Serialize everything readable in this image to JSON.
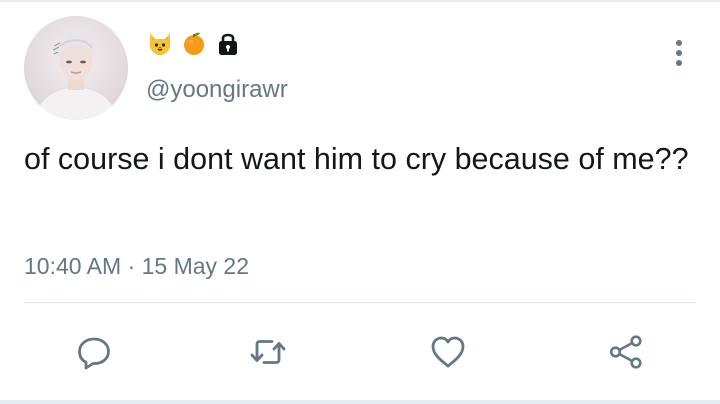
{
  "tweet": {
    "handle": "@yoongirawr",
    "display_name_emojis": [
      "cat-face-icon",
      "tangerine-icon",
      "lock-icon"
    ],
    "text": "of course i dont want him to cry because of me??",
    "timestamp": "10:40 AM · 15 May 22"
  },
  "actions": [
    "reply-icon",
    "retweet-icon",
    "like-icon",
    "share-icon"
  ],
  "colors": {
    "primary_text": "#14171a",
    "secondary_text": "#657786",
    "divider": "#e1e8ed",
    "icon": "#657786"
  }
}
